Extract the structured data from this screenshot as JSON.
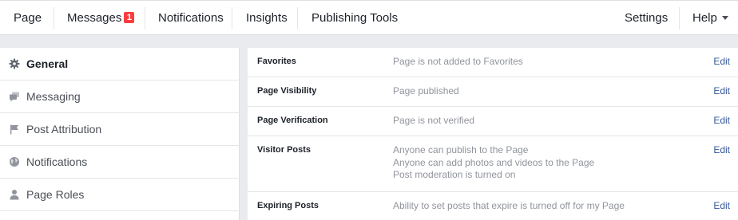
{
  "nav": {
    "left_items": [
      {
        "label": "Page"
      },
      {
        "label": "Messages",
        "badge": "1"
      },
      {
        "label": "Notifications"
      },
      {
        "label": "Insights"
      },
      {
        "label": "Publishing Tools"
      }
    ],
    "settings_label": "Settings",
    "help_label": "Help"
  },
  "sidebar": {
    "items": [
      {
        "label": "General",
        "icon": "gear-icon",
        "active": true
      },
      {
        "label": "Messaging",
        "icon": "chat-bubbles-icon",
        "active": false
      },
      {
        "label": "Post Attribution",
        "icon": "flag-icon",
        "active": false
      },
      {
        "label": "Notifications",
        "icon": "globe-icon",
        "active": false
      },
      {
        "label": "Page Roles",
        "icon": "person-icon",
        "active": false
      }
    ]
  },
  "settings": {
    "edit_label": "Edit",
    "rows": [
      {
        "name": "Favorites",
        "values": [
          "Page is not added to Favorites"
        ]
      },
      {
        "name": "Page Visibility",
        "values": [
          "Page published"
        ]
      },
      {
        "name": "Page Verification",
        "values": [
          "Page is not verified"
        ]
      },
      {
        "name": "Visitor Posts",
        "values": [
          "Anyone can publish to the Page",
          "Anyone can add photos and videos to the Page",
          "Post moderation is turned on"
        ]
      },
      {
        "name": "Expiring Posts",
        "values": [
          "Ability to set posts that expire is turned off for my Page"
        ]
      }
    ]
  },
  "colors": {
    "background": "#e9ebee",
    "link": "#365899",
    "badge": "#fa3e3e",
    "muted_text": "#90949c"
  }
}
